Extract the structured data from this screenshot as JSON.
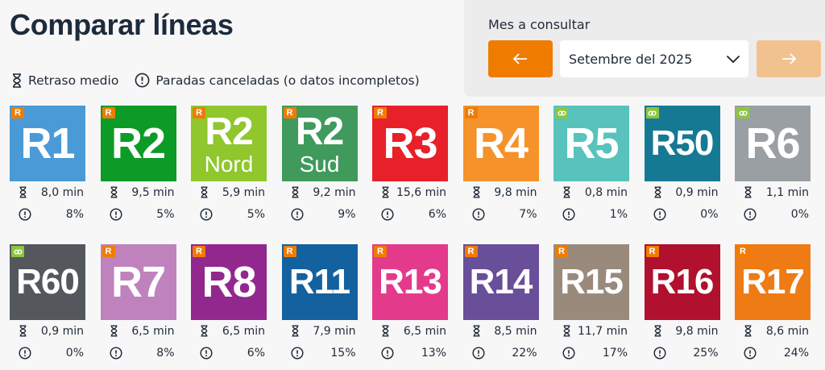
{
  "header": {
    "title": "Comparar líneas"
  },
  "legend": {
    "delay_label": "Retraso medio",
    "cancel_label": "Paradas canceladas (o datos incompletos)"
  },
  "month": {
    "label": "Mes a consultar",
    "selected": "Setembre del 2025",
    "colors": {
      "prev_button": "#ef7c00",
      "next_button": "#f2c28e"
    }
  },
  "lines": [
    {
      "code": "R1",
      "sub": "",
      "color": "#4a9ad7",
      "badge": "R",
      "delay": "8,0 min",
      "cancelled": "8%"
    },
    {
      "code": "R2",
      "sub": "",
      "color": "#0c9b27",
      "badge": "R",
      "delay": "9,5 min",
      "cancelled": "5%"
    },
    {
      "code": "R2",
      "sub": "Nord",
      "color": "#8fc72c",
      "badge": "R",
      "delay": "5,9 min",
      "cancelled": "5%"
    },
    {
      "code": "R2",
      "sub": "Sud",
      "color": "#3f9a5c",
      "badge": "R",
      "delay": "9,2 min",
      "cancelled": "9%"
    },
    {
      "code": "R3",
      "sub": "",
      "color": "#e8202a",
      "badge": "R",
      "delay": "15,6 min",
      "cancelled": "6%"
    },
    {
      "code": "R4",
      "sub": "",
      "color": "#f5922a",
      "badge": "R",
      "delay": "9,8 min",
      "cancelled": "7%"
    },
    {
      "code": "R5",
      "sub": "",
      "color": "#57c3bc",
      "badge": "link",
      "delay": "0,8 min",
      "cancelled": "1%"
    },
    {
      "code": "R50",
      "sub": "",
      "color": "#167994",
      "badge": "link",
      "delay": "0,9 min",
      "cancelled": "0%"
    },
    {
      "code": "R6",
      "sub": "",
      "color": "#9a9fa3",
      "badge": "link",
      "delay": "1,1 min",
      "cancelled": "0%"
    },
    {
      "code": "R60",
      "sub": "",
      "color": "#54585d",
      "badge": "link",
      "delay": "0,9 min",
      "cancelled": "0%"
    },
    {
      "code": "R7",
      "sub": "",
      "color": "#bf82bd",
      "badge": "R",
      "delay": "6,5 min",
      "cancelled": "8%"
    },
    {
      "code": "R8",
      "sub": "",
      "color": "#92288e",
      "badge": "R",
      "delay": "6,5 min",
      "cancelled": "6%"
    },
    {
      "code": "R11",
      "sub": "",
      "color": "#13619f",
      "badge": "R",
      "delay": "7,9 min",
      "cancelled": "15%"
    },
    {
      "code": "R13",
      "sub": "",
      "color": "#e43a8c",
      "badge": "R",
      "delay": "6,5 min",
      "cancelled": "13%"
    },
    {
      "code": "R14",
      "sub": "",
      "color": "#694e99",
      "badge": "R",
      "delay": "8,5 min",
      "cancelled": "22%"
    },
    {
      "code": "R15",
      "sub": "",
      "color": "#998a7c",
      "badge": "R",
      "delay": "11,7 min",
      "cancelled": "17%"
    },
    {
      "code": "R16",
      "sub": "",
      "color": "#b1102e",
      "badge": "R",
      "delay": "9,8 min",
      "cancelled": "25%"
    },
    {
      "code": "R17",
      "sub": "",
      "color": "#ef7b14",
      "badge": "R",
      "delay": "8,6 min",
      "cancelled": "24%"
    }
  ]
}
